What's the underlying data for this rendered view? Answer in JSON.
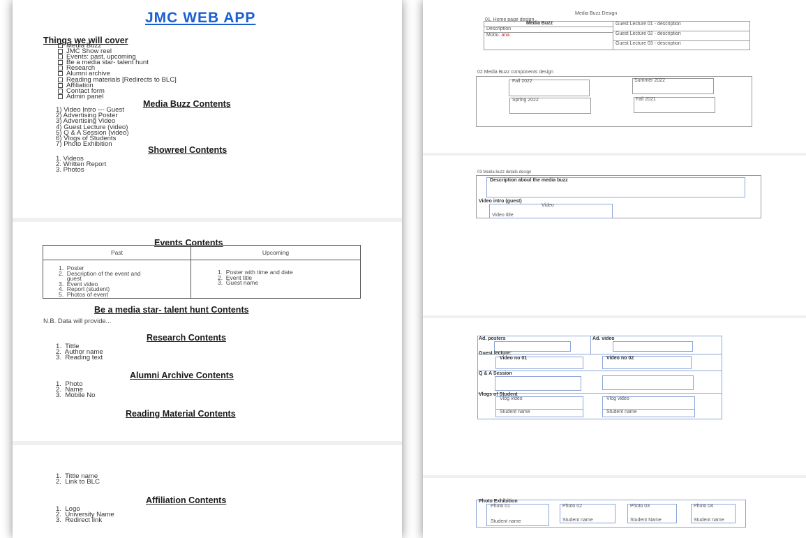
{
  "doc_title": "JMC WEB APP",
  "things": {
    "heading": "Things we will cover",
    "items": [
      "Media Buzz",
      "JMC Show reel",
      "Events: past, upcoming",
      "Be a media star- talent hunt",
      "Research",
      "Alumni archive",
      "Reading materials [Redirects to BLC]",
      "Affiliation",
      "Contact form",
      "Admin panel"
    ]
  },
  "media_buzz": {
    "heading": "Media Buzz Contents",
    "items": [
      "1) Video Intro --- Guest",
      "2) Advertising Poster",
      "3) Advertising Video",
      "4) Guest Lecture (video)",
      "5) Q & A Session (video)",
      "6) Vlogs of Students",
      "7) Photo Exhibition"
    ]
  },
  "showreel": {
    "heading": "Showreel Contents",
    "items": [
      "1.  Videos",
      "2.  Written Report",
      "3.  Photos"
    ]
  },
  "events": {
    "heading": "Events Contents",
    "past_header": "Past",
    "upcoming_header": "Upcoming",
    "past_items": [
      "1.  Poster",
      "2.  Description of the event and",
      "     guest",
      "3.  Event video",
      "4.  Report (student)",
      "5.  Photos of event"
    ],
    "upcoming_items": [
      "1.  Poster with time and date",
      "2.  Event title",
      "3.  Guest name"
    ]
  },
  "talent": {
    "heading": "Be a media star- talent hunt Contents",
    "note": "N.B. Data will provide..."
  },
  "research": {
    "heading": "Research Contents",
    "items": [
      "1.  Tittle",
      "2.  Author name",
      "3.  Reading text"
    ]
  },
  "alumni": {
    "heading": "Alumni Archive Contents",
    "items": [
      "1.  Photo",
      "2.  Name",
      "3.  Mobile No"
    ]
  },
  "reading": {
    "heading": "Reading Material Contents",
    "items": [
      "1.  Tittle name",
      "2.  Link to BLC"
    ]
  },
  "affiliation": {
    "heading": "Affiliation Contents",
    "items": [
      "1.  Logo",
      "2.  University Name",
      "3.  Redirect link"
    ]
  },
  "design": {
    "top_title": "Media Buzz Design",
    "home": {
      "label": "01. Home page design",
      "media_buzz": "Media Buzz",
      "description": "Description",
      "motto_prefix": "Motto: ",
      "motto_red": "ana",
      "lectures": [
        "Guest Lecture 01 - description",
        "Guest Lecture 02 - description",
        "Guest Lecture 03 - description"
      ]
    },
    "components": {
      "label": "02 Media Buzz components design",
      "semesters": [
        "Fall 2022",
        "Summer 2022",
        "Spring 2022",
        "Fall 2021"
      ]
    },
    "details": {
      "label": "03 Media buzz details design",
      "description": "Description about the media buzz",
      "video_intro": "Video intro (guest)",
      "video": "Video",
      "video_title": "Video title"
    },
    "ads": {
      "posters": "Ad. posters",
      "video": "Ad. video",
      "guest_lecture": "Guest lecture:",
      "video_01": "Video no 01",
      "video_02": "Video no 02",
      "qa": "Q & A Session",
      "vlogs": "Vlogs of Student",
      "vlog_video": "Vlog video",
      "student_name": "Student name"
    },
    "photo": {
      "label": "Photo Exhibition",
      "photos": [
        "Photo 01",
        "Photo 02",
        "Photo 03",
        "Photo 04"
      ],
      "names": [
        "Student name",
        "Student name",
        "Student Name",
        "Student name"
      ]
    }
  }
}
